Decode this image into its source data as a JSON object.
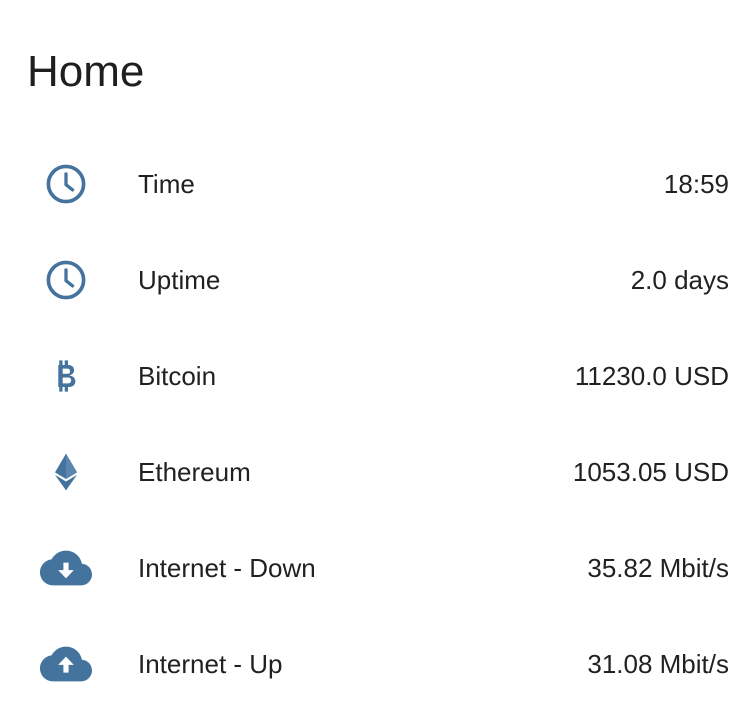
{
  "card": {
    "title": "Home",
    "accent_color": "#44739e"
  },
  "rows": [
    {
      "icon": "clock-icon",
      "label": "Time",
      "value": "18:59"
    },
    {
      "icon": "clock-icon",
      "label": "Uptime",
      "value": "2.0 days"
    },
    {
      "icon": "bitcoin-icon",
      "label": "Bitcoin",
      "value": "11230.0 USD"
    },
    {
      "icon": "ethereum-icon",
      "label": "Ethereum",
      "value": "1053.05 USD"
    },
    {
      "icon": "cloud-download-icon",
      "label": "Internet - Down",
      "value": "35.82 Mbit/s"
    },
    {
      "icon": "cloud-upload-icon",
      "label": "Internet - Up",
      "value": "31.08 Mbit/s"
    }
  ]
}
